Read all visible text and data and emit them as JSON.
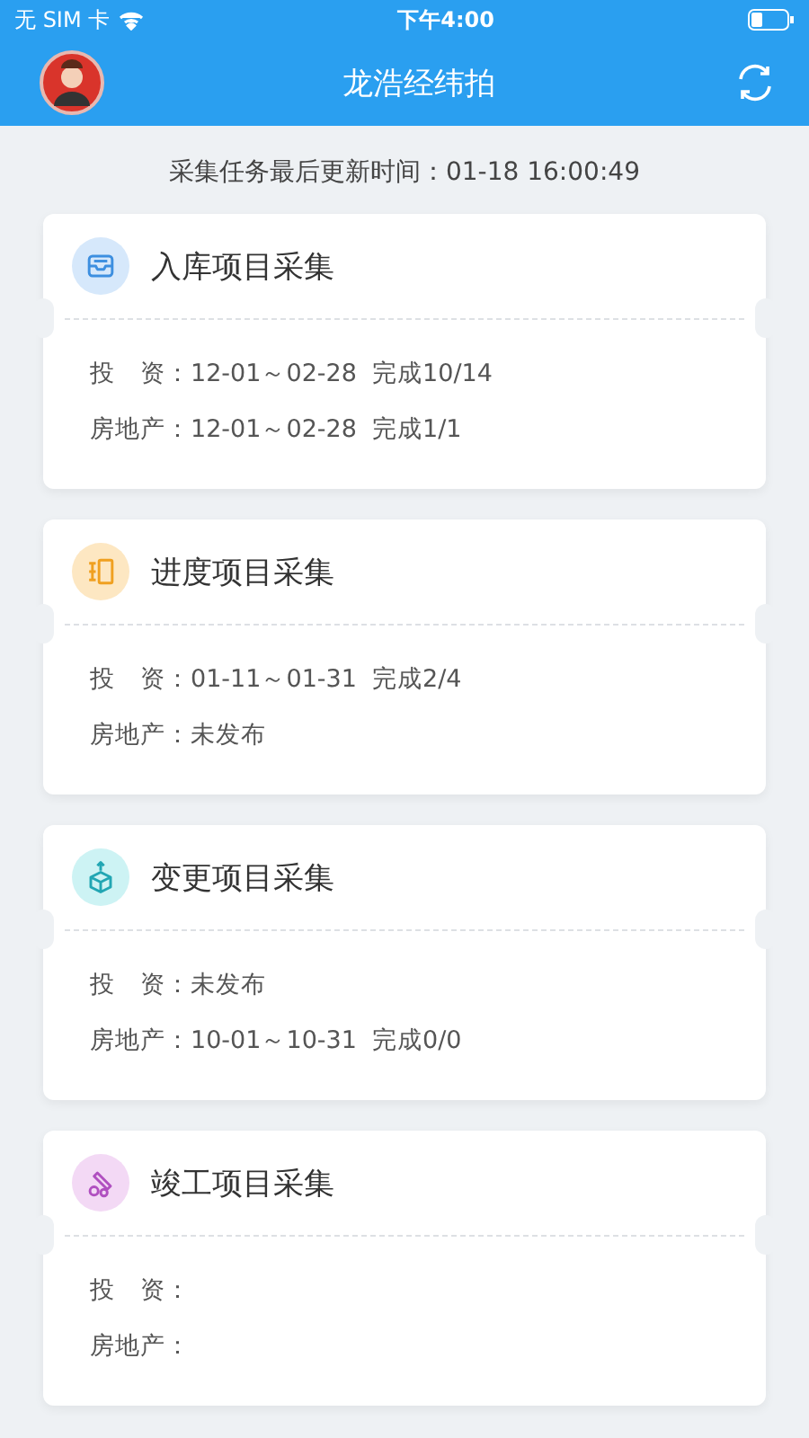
{
  "status_bar": {
    "carrier": "无 SIM 卡",
    "time": "下午4:00"
  },
  "header": {
    "title": "龙浩经纬拍"
  },
  "update_notice": "采集任务最后更新时间：01-18 16:00:49",
  "cards": [
    {
      "title": "入库项目采集",
      "kind": "inbox",
      "color": "#d6e8fb",
      "lines": [
        "投　资：12-01～02-28  完成10/14",
        "房地产：12-01～02-28  完成1/1"
      ]
    },
    {
      "title": "进度项目采集",
      "kind": "schedule",
      "color": "#fde7c2",
      "lines": [
        "投　资：01-11～01-31  完成2/4",
        "房地产：未发布"
      ]
    },
    {
      "title": "变更项目采集",
      "kind": "cube",
      "color": "#cdf3f4",
      "lines": [
        "投　资：未发布",
        "房地产：10-01～10-31  完成0/0"
      ]
    },
    {
      "title": "竣工项目采集",
      "kind": "tools",
      "color": "#f3d9f5",
      "lines": [
        "投　资：",
        "房地产："
      ]
    }
  ]
}
